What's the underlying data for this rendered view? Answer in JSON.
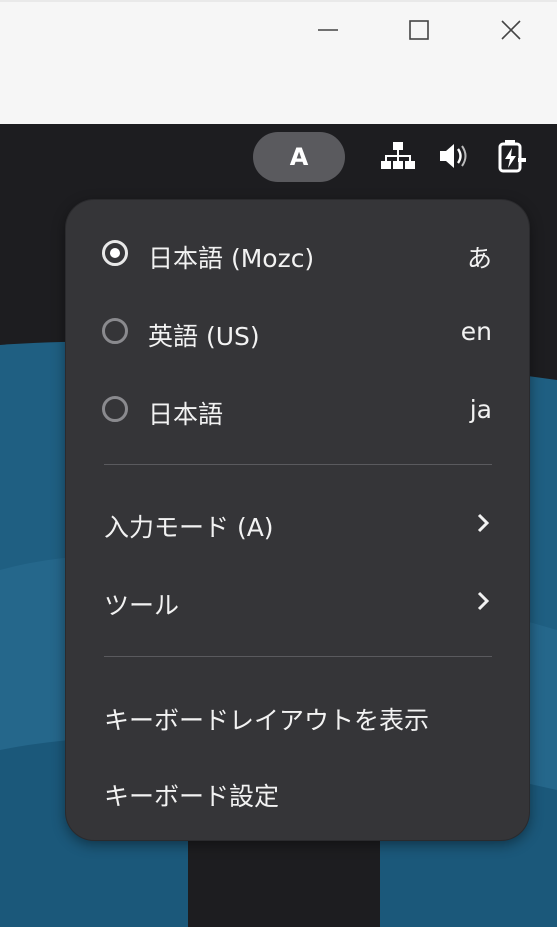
{
  "window": {
    "minimize_icon": "minimize-icon",
    "maximize_icon": "maximize-icon",
    "close_icon": "close-icon"
  },
  "panel": {
    "ime_indicator": "A",
    "tray": [
      "network-icon",
      "volume-icon",
      "battery-charging-icon"
    ]
  },
  "menu": {
    "input_methods": [
      {
        "label": "日本語 (Mozc)",
        "shortcut": "あ",
        "selected": true
      },
      {
        "label": "英語 (US)",
        "shortcut": "en",
        "selected": false
      },
      {
        "label": "日本語",
        "shortcut": "ja",
        "selected": false
      }
    ],
    "submenus": [
      {
        "label": "入力モード (A)"
      },
      {
        "label": "ツール"
      }
    ],
    "actions": [
      {
        "label": "キーボードレイアウトを表示"
      },
      {
        "label": "キーボード設定"
      }
    ]
  },
  "colors": {
    "menu_background": "#353538",
    "panel_background": "#1d1d20",
    "desktop_blue": "#1f5f82",
    "pill": "#5a5a5e"
  }
}
